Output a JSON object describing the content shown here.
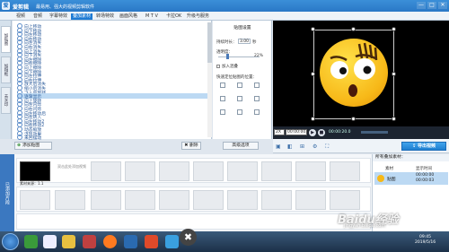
{
  "app": {
    "logo": "爱",
    "title": "爱剪辑",
    "subtitle": "最易用、强大的视频剪辑软件"
  },
  "window_controls": [
    "—",
    "□",
    "✕"
  ],
  "menu": [
    {
      "label": "视频"
    },
    {
      "label": "音频"
    },
    {
      "label": "字幕特效"
    },
    {
      "label": "叠加素材"
    },
    {
      "label": "转场特效"
    },
    {
      "label": "画面风格"
    },
    {
      "label": "M T V"
    },
    {
      "label": "卡拉OK"
    },
    {
      "label": "升级与服务"
    }
  ],
  "left_tabs": [
    "加贴图",
    "加相框",
    "去水印"
  ],
  "effects": [
    "向上移动",
    "向下移动",
    "向左移动",
    "向右移动",
    "向左消失",
    "向右消失",
    "向上消失",
    "向下消失",
    "向左擦除",
    "向右擦除",
    "向上擦除",
    "向下擦除",
    "向左拉伸",
    "向右拉伸",
    "放大后消失",
    "缩小后消失",
    "飞入后旋转",
    "逐渐显示",
    "向上旋转",
    "向左闪烁",
    "向右闪烁",
    "向左移动后",
    "向左转入",
    "向左移动2",
    "向右移动2",
    "动态缩放",
    "浮现效果",
    "来回摆动"
  ],
  "selected_effect_index": 17,
  "buttons": {
    "add_overlay": "添加贴图",
    "delete": "✖ 删除",
    "advanced": "高级选项",
    "export": "导出视频"
  },
  "props": {
    "title": "贴图设置",
    "duration_label": "持续时长：",
    "duration_value": "3.00",
    "duration_unit": "秒",
    "opacity_label": "透明度：",
    "opacity_value": "22%",
    "opacity_fraction": 0.22,
    "flag_label": "加入混叠",
    "position_label": "快速定位贴图的位置："
  },
  "player": {
    "time_current": "00:00:00.0",
    "time_total": "00:00:20.0",
    "zoom": "2X"
  },
  "timeline": {
    "header": "已添加片段",
    "clip_label": "素材来源：1.1",
    "drag_hint": "双击此处添加视频"
  },
  "overlay_list": {
    "title": "所有叠加素材：",
    "columns": [
      "素材",
      "显示时间"
    ],
    "rows": [
      {
        "name": "贴图",
        "start": "00:00:00",
        "end": "00:00:03"
      }
    ]
  },
  "taskbar": {
    "time": "09:45",
    "date": "2019/5/16"
  },
  "watermark": {
    "text": "Baidu经验",
    "url": "jingyan.baidu.com"
  },
  "colors": {
    "accent": "#2a78c6",
    "selected": "#bcd9f3",
    "face": "#f7b818"
  }
}
